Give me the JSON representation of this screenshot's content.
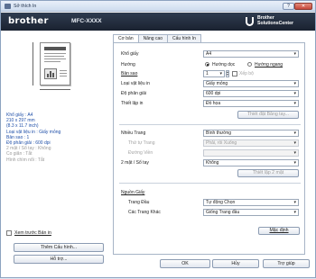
{
  "window": {
    "title": "Sở thích In",
    "help_label": "?",
    "close_label": "✕"
  },
  "banner": {
    "brand": "brother",
    "model": "MFC-XXXX",
    "solutions_line1": "Brother",
    "solutions_line2": "SolutionsCenter"
  },
  "summary": {
    "paper_size": "Khổ giấy : A4",
    "paper_dims_mm": "210 x 297 mm",
    "paper_dims_in": "(8.3 x 11.7 inch)",
    "media_type": "Loại vật liệu in : Giấy mỏng",
    "copies": "Bản sao : 1",
    "resolution": "Độ phân giải : 600 dpi",
    "duplex": "2 mặt / Sổ tay : Không",
    "scaling": "Co giãn : Tắt",
    "watermark": "Hình chìm nổi : Tắt"
  },
  "preview_checkbox": {
    "label": "Xem trước Bản in"
  },
  "left_buttons": {
    "add_profile": "Thêm Cấu hình...",
    "support": "Hỗ trợ..."
  },
  "tabs": [
    "Cơ bản",
    "Nâng cao",
    "Cấu hình In"
  ],
  "basic": {
    "paper_size_label": "Khổ giấy",
    "paper_size_value": "A4",
    "orientation_label": "Hướng",
    "orientation_portrait": "Hướng dọc",
    "orientation_landscape": "Hướng ngang",
    "copies_label": "Bản sao",
    "copies_value": "1",
    "collate_label": "Xếp bộ",
    "media_label": "Loại vật liệu in",
    "media_value": "Giấy mỏng",
    "resolution_label": "Độ phân giải",
    "resolution_value": "600 dpi",
    "print_settings_label": "Thiết lập in",
    "print_settings_value": "Đồ họa",
    "manual_settings_button": "Thiết đặt Bằng tay...",
    "multipage_label": "Nhiều Trang",
    "multipage_value": "Bình thường",
    "page_order_label": "Thứ tự Trang",
    "page_order_value": "Phải, rồi Xuống",
    "border_line_label": "Đường Viền",
    "border_line_value": "",
    "duplex_label": "2 mặt / Sổ tay",
    "duplex_value": "Không",
    "duplex_settings_button": "Thiết lập 2 mặt",
    "paper_source_label": "Nguồn Giấy",
    "first_page_label": "Trang Đầu",
    "first_page_value": "Tự động Chọn",
    "other_pages_label": "Các Trang Khác",
    "other_pages_value": "Giống Trang đầu",
    "default_button": "Mặc định"
  },
  "footer": {
    "ok": "OK",
    "cancel": "Hủy",
    "help": "Trợ giúp"
  },
  "colors": {
    "banner": "#1a2230",
    "link_blue": "#1f4fa8"
  }
}
